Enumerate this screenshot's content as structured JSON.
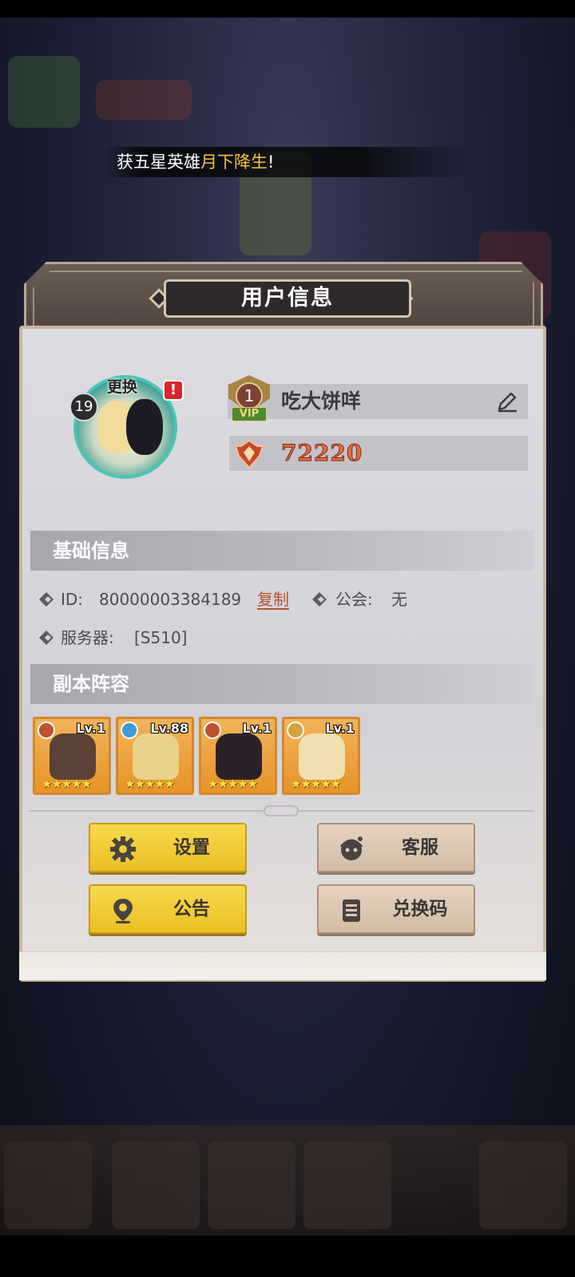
{
  "toast": {
    "prefix": "获五星英雄",
    "highlight": "月下降生",
    "suffix": "!"
  },
  "dialog": {
    "title": "用户信息"
  },
  "profile": {
    "level": "19",
    "change_label": "更换",
    "alert": "!",
    "vip_level": "1",
    "vip_tag": "VIP",
    "username": "吃大饼咩",
    "power": "72220"
  },
  "basic_info": {
    "heading": "基础信息",
    "id_label": "ID:",
    "id_value": "80000003384189",
    "copy_label": "复制",
    "guild_label": "公会:",
    "guild_value": "无",
    "server_label": "服务器:",
    "server_value": "[S510]"
  },
  "lineup": {
    "heading": "副本阵容",
    "heroes": [
      {
        "level": "Lv.1",
        "stars": "★★★★★",
        "element_color": "#c0522d",
        "art_color": "#5a4236"
      },
      {
        "level": "Lv.88",
        "stars": "★★★★★",
        "element_color": "#3f9ad6",
        "art_color": "#e9d28a"
      },
      {
        "level": "Lv.1",
        "stars": "★★★★★",
        "element_color": "#c0522d",
        "art_color": "#2a2228"
      },
      {
        "level": "Lv.1",
        "stars": "★★★★★",
        "element_color": "#d6a23a",
        "art_color": "#efe0b0"
      }
    ]
  },
  "buttons": {
    "settings": "设置",
    "support": "客服",
    "notice": "公告",
    "redeem": "兑换码"
  },
  "colors": {
    "accent_yellow": "#f2c23c",
    "power": "#e86a3c",
    "copy_link": "#b3532b"
  }
}
